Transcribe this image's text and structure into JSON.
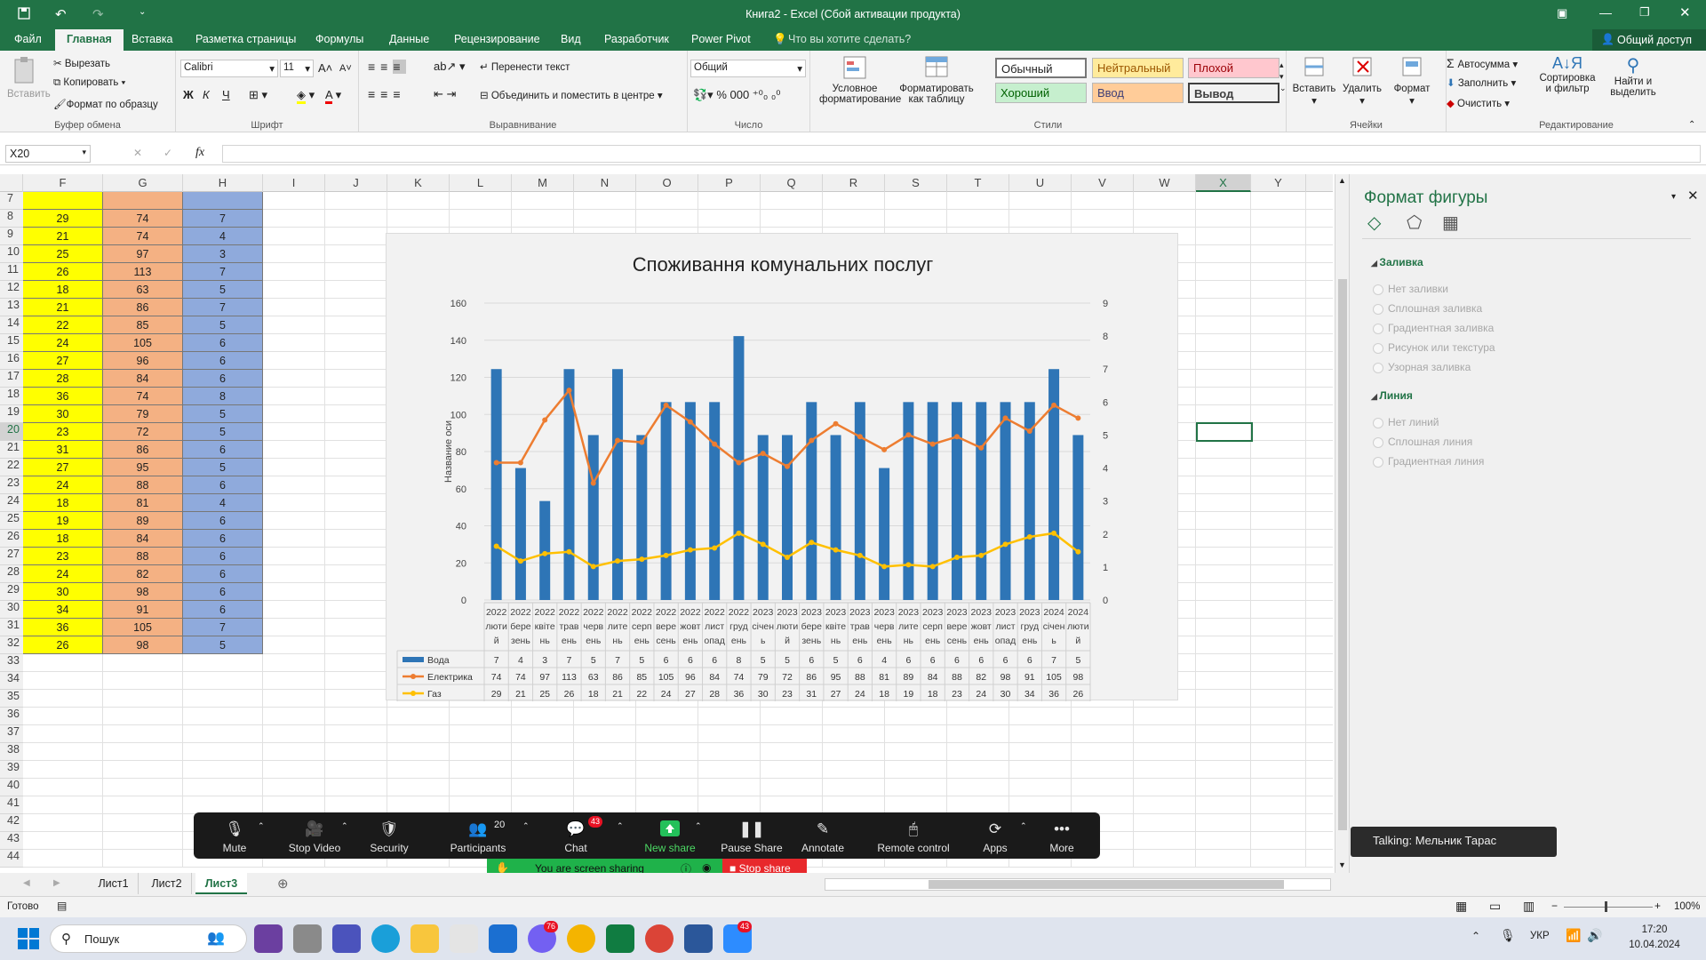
{
  "titlebar": {
    "title": "Книга2 - Excel (Сбой активации продукта)",
    "qat": [
      "save-icon",
      "undo-icon",
      "redo-icon",
      "customize-icon"
    ]
  },
  "tabs": {
    "file": "Файл",
    "home": "Главная",
    "insert": "Вставка",
    "layout": "Разметка страницы",
    "formulas": "Формулы",
    "data": "Данные",
    "review": "Рецензирование",
    "view": "Вид",
    "developer": "Разработчик",
    "powerpivot": "Power Pivot",
    "tell": "Что вы хотите сделать?",
    "share": "Общий доступ"
  },
  "ribbon": {
    "clipboard": {
      "paste": "Вставить",
      "cut": "Вырезать",
      "copy": "Копировать",
      "painter": "Формат по образцу",
      "label": "Буфер обмена"
    },
    "font": {
      "name": "Calibri",
      "size": "11",
      "bold": "Ж",
      "italic": "К",
      "underline": "Ч",
      "label": "Шрифт"
    },
    "align": {
      "wrap": "Перенести текст",
      "merge": "Объединить и поместить в центре",
      "label": "Выравнивание"
    },
    "number": {
      "format": "Общий",
      "label": "Число"
    },
    "styles": {
      "cond": "Условное форматирование",
      "table": "Форматировать как таблицу",
      "normal": "Обычный",
      "neutral": "Нейтральный",
      "bad": "Плохой",
      "good": "Хороший",
      "input": "Ввод",
      "output": "Вывод",
      "label": "Стили"
    },
    "cells": {
      "insert": "Вставить",
      "delete": "Удалить",
      "format": "Формат",
      "label": "Ячейки"
    },
    "editing": {
      "autosum": "Автосумма",
      "fill": "Заполнить",
      "clear": "Очистить",
      "sort": "Сортировка и фильтр",
      "find": "Найти и выделить",
      "label": "Редактирование"
    }
  },
  "formula": {
    "namebox": "X20",
    "fx": "fx",
    "value": ""
  },
  "columns": [
    "F",
    "G",
    "H",
    "I",
    "J",
    "K",
    "L",
    "M",
    "N",
    "O",
    "P",
    "Q",
    "R",
    "S",
    "T",
    "U",
    "V",
    "W",
    "X",
    "Y"
  ],
  "rows": [
    "7",
    "8",
    "9",
    "10",
    "11",
    "12",
    "13",
    "14",
    "15",
    "16",
    "17",
    "18",
    "19",
    "20",
    "21",
    "22",
    "23",
    "24",
    "25",
    "26",
    "27",
    "28",
    "29",
    "30",
    "31",
    "32",
    "33",
    "34",
    "35",
    "36",
    "37",
    "38",
    "39",
    "40",
    "41",
    "42",
    "43",
    "44"
  ],
  "table": {
    "F": [
      29,
      21,
      25,
      26,
      18,
      21,
      22,
      24,
      27,
      28,
      36,
      30,
      23,
      31,
      27,
      24,
      18,
      19,
      18,
      23,
      24,
      30,
      34,
      36,
      26
    ],
    "G": [
      74,
      74,
      97,
      113,
      63,
      86,
      85,
      105,
      96,
      84,
      74,
      79,
      72,
      86,
      95,
      88,
      81,
      89,
      84,
      88,
      82,
      98,
      91,
      105,
      98
    ],
    "H": [
      7,
      4,
      3,
      7,
      5,
      7,
      5,
      6,
      6,
      6,
      8,
      5,
      5,
      6,
      5,
      6,
      4,
      6,
      6,
      6,
      6,
      6,
      6,
      7,
      5
    ]
  },
  "chart_data": {
    "type": "bar",
    "title": "Споживання комунальних послуг",
    "ylabel": "Название оси",
    "ylim": [
      0,
      160
    ],
    "y2lim": [
      0,
      9
    ],
    "categories": [
      "2022 лютий",
      "2022 березень",
      "2022 квітень",
      "2022 травень",
      "2022 червень",
      "2022 липень",
      "2022 серпень",
      "2022 вересень",
      "2022 жовтень",
      "2022 листопад",
      "2022 грудень",
      "2023 січень",
      "2023 лютий",
      "2023 березень",
      "2023 квітень",
      "2023 травень",
      "2023 червень",
      "2023 липень",
      "2023 серпень",
      "2023 вересень",
      "2023 жовтень",
      "2023 листопад",
      "2023 грудень",
      "2024 січень",
      "2024 лютий"
    ],
    "cat_lines": [
      [
        "2022",
        "люти",
        "й"
      ],
      [
        "2022",
        "бере",
        "зень"
      ],
      [
        "2022",
        "квіте",
        "нь"
      ],
      [
        "2022",
        "трав",
        "ень"
      ],
      [
        "2022",
        "черв",
        "ень"
      ],
      [
        "2022",
        "лите",
        "нь"
      ],
      [
        "2022",
        "серп",
        "ень"
      ],
      [
        "2022",
        "вере",
        "сень"
      ],
      [
        "2022",
        "жовт",
        "ень"
      ],
      [
        "2022",
        "лист",
        "опад"
      ],
      [
        "2022",
        "груд",
        "ень"
      ],
      [
        "2023",
        "січен",
        "ь"
      ],
      [
        "2023",
        "люти",
        "й"
      ],
      [
        "2023",
        "бере",
        "зень"
      ],
      [
        "2023",
        "квіте",
        "нь"
      ],
      [
        "2023",
        "трав",
        "ень"
      ],
      [
        "2023",
        "черв",
        "ень"
      ],
      [
        "2023",
        "лите",
        "нь"
      ],
      [
        "2023",
        "серп",
        "ень"
      ],
      [
        "2023",
        "вере",
        "сень"
      ],
      [
        "2023",
        "жовт",
        "ень"
      ],
      [
        "2023",
        "лист",
        "опад"
      ],
      [
        "2023",
        "груд",
        "ень"
      ],
      [
        "2024",
        "січен",
        "ь"
      ],
      [
        "2024",
        "люти",
        "й"
      ]
    ],
    "series": [
      {
        "name": "Вода",
        "type": "bar",
        "axis": "secondary",
        "color": "#2e75b6",
        "values": [
          7,
          4,
          3,
          7,
          5,
          7,
          5,
          6,
          6,
          6,
          8,
          5,
          5,
          6,
          5,
          6,
          4,
          6,
          6,
          6,
          6,
          6,
          6,
          7,
          5
        ]
      },
      {
        "name": "Електрика",
        "type": "line",
        "axis": "primary",
        "color": "#ed7d31",
        "values": [
          74,
          74,
          97,
          113,
          63,
          86,
          85,
          105,
          96,
          84,
          74,
          79,
          72,
          86,
          95,
          88,
          81,
          89,
          84,
          88,
          82,
          98,
          91,
          105,
          98
        ]
      },
      {
        "name": "Газ",
        "type": "line",
        "axis": "primary",
        "color": "#ffc000",
        "values": [
          29,
          21,
          25,
          26,
          18,
          21,
          22,
          24,
          27,
          28,
          36,
          30,
          23,
          31,
          27,
          24,
          18,
          19,
          18,
          23,
          24,
          30,
          34,
          36,
          26
        ]
      }
    ],
    "legend": "bottom-data-table",
    "grid": true
  },
  "pane": {
    "title": "Формат фигуры",
    "fill": "Заливка",
    "fill_opts": [
      "Нет заливки",
      "Сплошная заливка",
      "Градиентная заливка",
      "Рисунок или текстура",
      "Узорная заливка"
    ],
    "line": "Линия",
    "line_opts": [
      "Нет линий",
      "Сплошная линия",
      "Градиентная линия"
    ]
  },
  "zoom": {
    "mute": "Mute",
    "video": "Stop Video",
    "security": "Security",
    "participants": "Participants",
    "participants_count": "20",
    "chat": "Chat",
    "chat_badge": "43",
    "newshare": "New share",
    "pause": "Pause Share",
    "annotate": "Annotate",
    "remote": "Remote control",
    "apps": "Apps",
    "more": "More",
    "sharing": "You are screen sharing",
    "stop": "Stop share",
    "talking": "Talking: Мельник Тарас"
  },
  "sheets": [
    "Лист1",
    "Лист2",
    "Лист3"
  ],
  "status": {
    "ready": "Готово",
    "zoom": "100%"
  },
  "taskbar": {
    "search": "Пошук",
    "lang": "УКР",
    "time": "17:20",
    "date": "10.04.2024",
    "viber_badge": "76",
    "zoom_badge": "43"
  }
}
